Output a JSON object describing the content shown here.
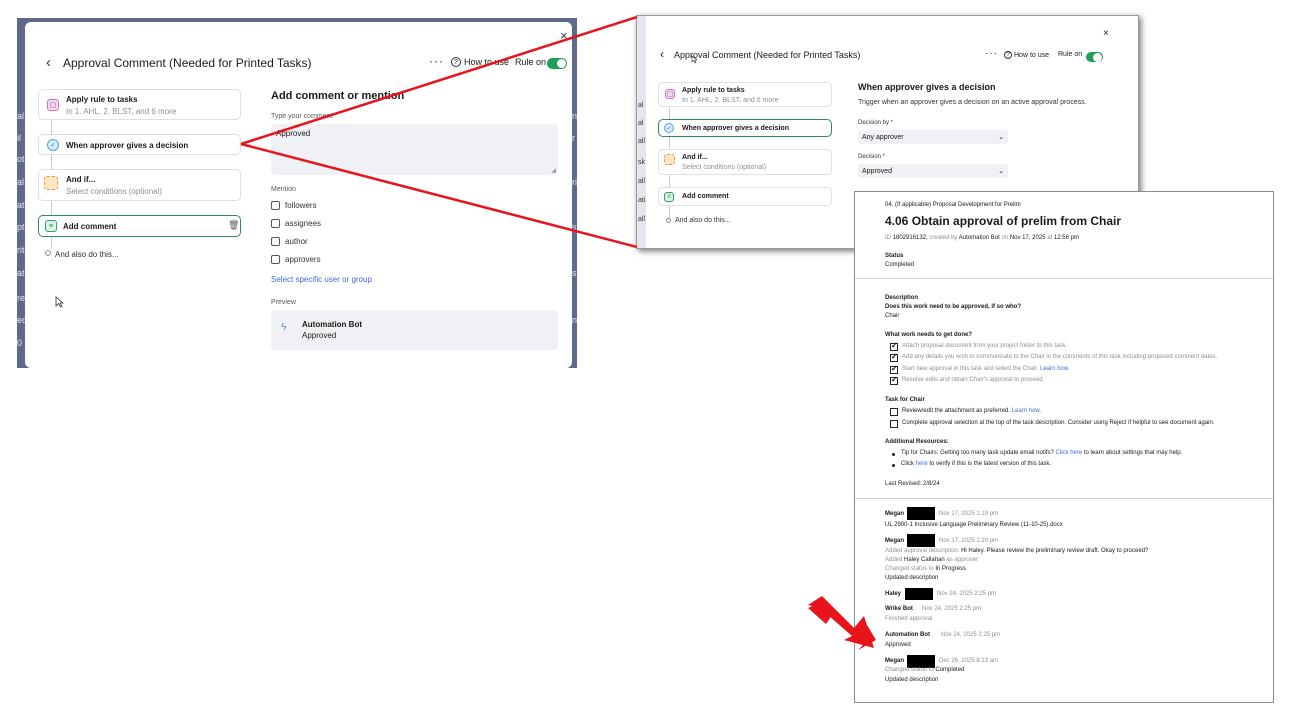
{
  "panel1": {
    "title": "Approval Comment (Needed for Printed Tasks)",
    "close": "×",
    "back": "‹",
    "more": "···",
    "how_to_use": "How to use",
    "rule_on": "Rule on",
    "edge_left": [
      "al",
      "il",
      "ot",
      "al",
      "at",
      "pt",
      "rit",
      "at",
      "re",
      "ed",
      "0"
    ],
    "edge_right": [
      "n",
      "r",
      "ri",
      "s",
      "s",
      "n"
    ],
    "steps": [
      {
        "title": "Apply rule to tasks",
        "subtitle": "In 1. AHL, 2. BLST, and 6 more"
      },
      {
        "title": "When approver gives a decision"
      },
      {
        "title": "And if...",
        "subtitle": "Select conditions (optional)"
      },
      {
        "title": "Add comment"
      }
    ],
    "and_also": "And also do this...",
    "section_title": "Add comment or mention",
    "type_label": "Type your comment",
    "comment_value": "Approved",
    "mention_label": "Mention",
    "mention_options": [
      "followers",
      "assignees",
      "author",
      "approvers"
    ],
    "select_specific": "Select specific user or group",
    "preview_label": "Preview",
    "preview_name": "Automation Bot",
    "preview_text": "Approved"
  },
  "panel2": {
    "title": "Approval Comment (Needed for Printed Tasks)",
    "close": "×",
    "back": "‹",
    "more": "···",
    "how_to_use": "How to use",
    "rule_on": "Rule on",
    "edge_left": [
      "al",
      "al",
      "all",
      "sk",
      "all",
      "ati",
      "all"
    ],
    "steps": [
      {
        "title": "Apply rule to tasks",
        "subtitle": "In 1. AHL, 2. BLST, and 6 more"
      },
      {
        "title": "When approver gives a decision"
      },
      {
        "title": "And if...",
        "subtitle": "Select conditions (optional)"
      },
      {
        "title": "Add comment"
      }
    ],
    "and_also": "And also do this...",
    "section_title": "When approver gives a decision",
    "section_desc": "Trigger when an approver gives a decision on an active approval process.",
    "decision_by_label": "Decision by *",
    "decision_by_value": "Any approver",
    "decision_label": "Decision *",
    "decision_value": "Approved",
    "chevron": "⌄"
  },
  "panel3": {
    "breadcrumb": "04. (If applicable) Proposal Development for Prelim",
    "title": "4.06 Obtain approval of prelim from Chair",
    "id_prefix": "ID",
    "id_value": "1802916132",
    "created_by_prefix": "created by",
    "created_by": "Automation Bot",
    "on_prefix": "on",
    "created_date": "Nov 17, 2025",
    "at_prefix": "at",
    "created_time": "12:56 pm",
    "status_label": "Status",
    "status_value": "Completed",
    "description_label": "Description",
    "q1": "Does this work need to be approved, if so who?",
    "a1": "Chair",
    "work_heading": "What work needs to get done?",
    "work_items": [
      "Attach proposal document from your project folder to this task.",
      "Add any details you wish to communicate to the Chair in the comments of this task including proposed comment dates.",
      "Start new approval in this task and select the Chair.",
      "Resolve edits and obtain Chair's approval to proceed."
    ],
    "learn_how": "Learn how.",
    "chair_heading": "Task for Chair",
    "chair_items": [
      "Review/edit the attachment as preferred.",
      "Complete approval selection at the top of the task description. Consider using Reject if helpful to see document again."
    ],
    "resources_heading": "Additional Resources:",
    "res1_a": "Tip for Chairs: Getting too many task update email notifs?",
    "res1_link": "Click here",
    "res1_b": "to learn about settings that may help.",
    "res2_a": "Click",
    "res2_link": "here",
    "res2_b": "to verify if this is the latest version of this task.",
    "last_revised": "Last Revised: 2/8/24",
    "activity": {
      "megan1_name": "Megan",
      "megan1_time": "Nov 17, 2025 1:19 pm",
      "megan1_file": "UL 2900-1 Inclusive Language Preliminary Review (11-10-25).docx",
      "megan2_name": "Megan",
      "megan2_time": "Nov 17, 2025 1:20 pm",
      "megan2_l1a": "Added approval description:",
      "megan2_l1b": "Hi Haley. Please review the preliminary review draft. Okay to proceed?",
      "megan2_l2a": "Added",
      "megan2_l2b": "Haley Callahan",
      "megan2_l2c": "as approver",
      "megan2_l3a": "Changed status to",
      "megan2_l3b": "In Progress",
      "megan2_l4": "Updated description",
      "haley_name": "Haley",
      "haley_time": "Nov 24, 2025 2:25 pm",
      "wrike_name": "Wrike Bot",
      "wrike_time": "Nov 24, 2025 2:25 pm",
      "wrike_text": "Finished approval",
      "auto_name": "Automation Bot",
      "auto_time": "Nov 24, 2025 2:25 pm",
      "auto_text": "Approved",
      "megan3_name": "Megan",
      "megan3_time": "Dec 26, 2025 8:13 am",
      "megan3_l1a": "Changed status to",
      "megan3_l1b": "Completed",
      "megan3_l2": "Updated description"
    }
  },
  "colors": {
    "backdrop": "#5d6a8c",
    "accent_green": "#1e9e56",
    "link_blue": "#3b6dd1",
    "annotation_red": "#e8141b"
  }
}
